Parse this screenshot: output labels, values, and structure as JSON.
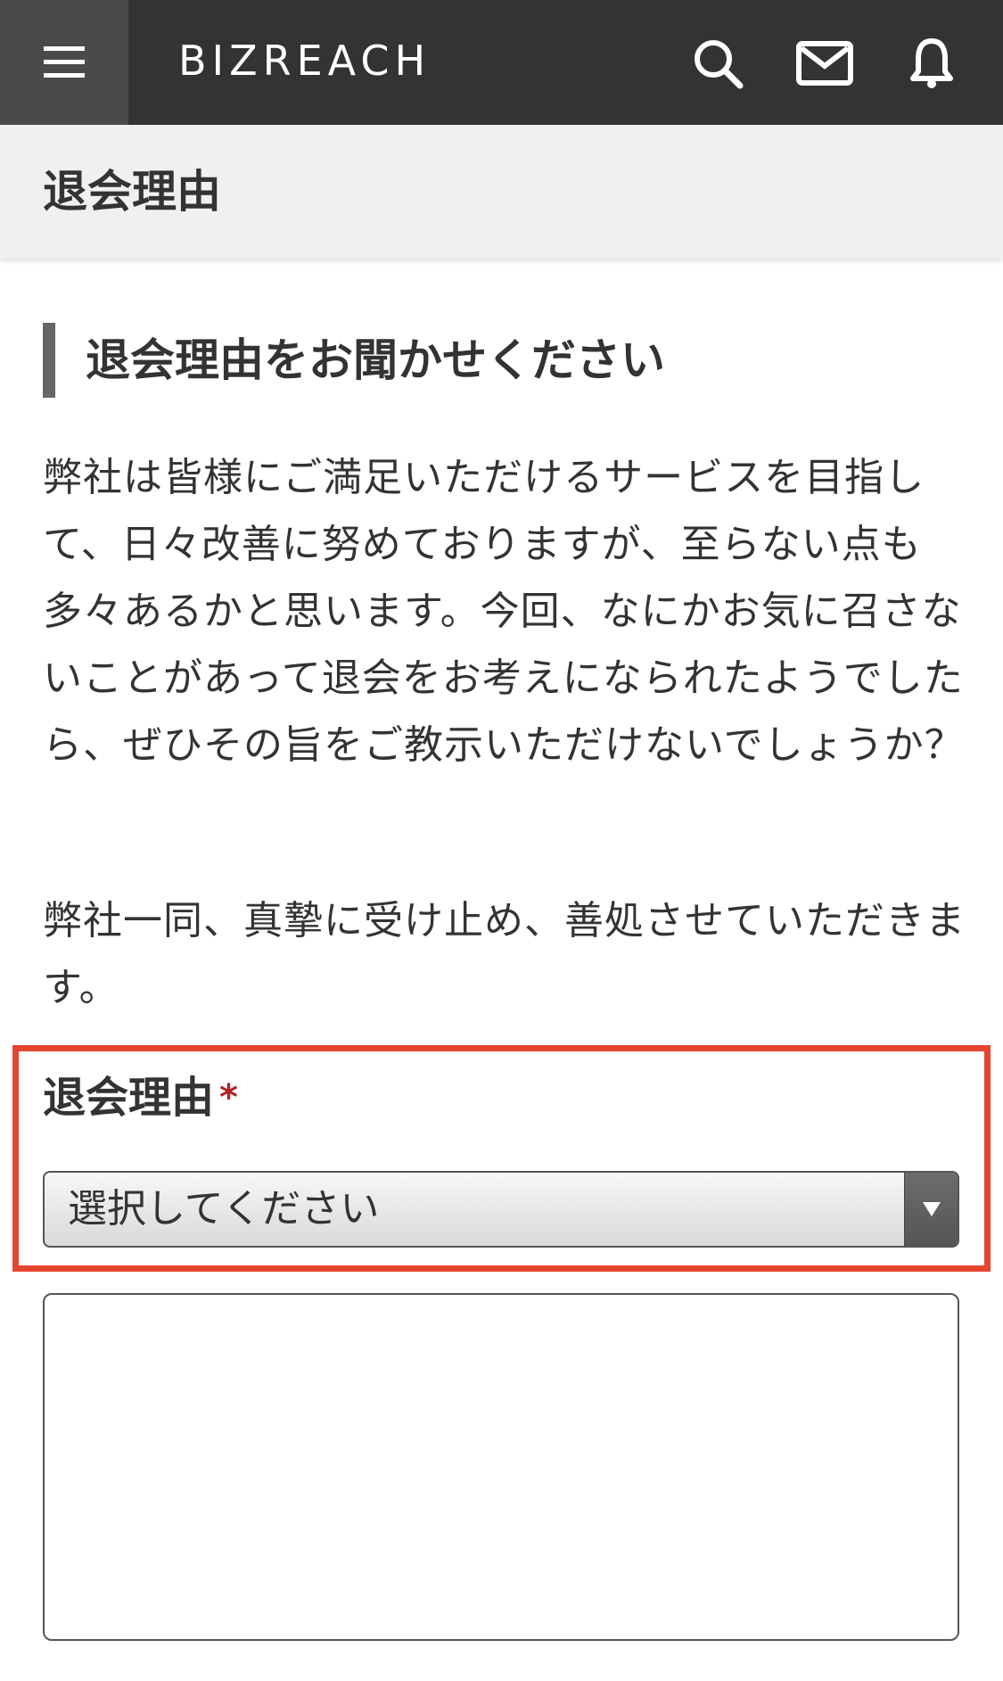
{
  "header": {
    "logo_text": "BIZREAC",
    "logo_tail": "H",
    "icons": [
      "menu-icon",
      "search-icon",
      "mail-icon",
      "bell-icon"
    ],
    "bg_color": "#333333"
  },
  "page": {
    "title": "退会理由"
  },
  "section": {
    "heading": "退会理由をお聞かせください",
    "paragraph1": "弊社は皆様にご満足いただけるサービスを目指して、日々改善に努めておりますが、至らない点も多々あるかと思います。今回、なにかお気に召さないことがあって退会をお考えになられたようでしたら、ぜひその旨をご教示いただけないでしょうか？",
    "paragraph2": "弊社一同、真摯に受け止め、善処させていただきます。"
  },
  "form": {
    "reason_label": "退会理由",
    "required_mark": "*",
    "select_placeholder": "選択してください",
    "highlight_color": "#e5452e",
    "textarea_value": ""
  }
}
